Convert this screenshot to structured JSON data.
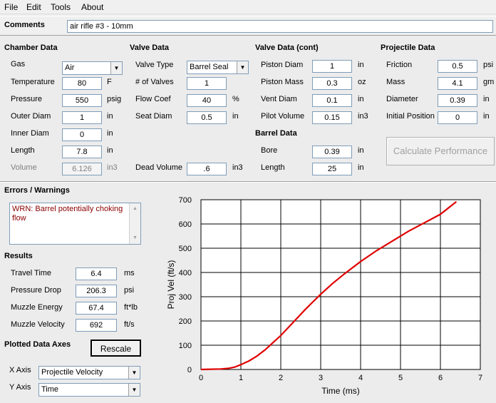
{
  "menu": {
    "file": "File",
    "edit": "Edit",
    "tools": "Tools",
    "about": "About"
  },
  "comments": {
    "label": "Comments",
    "value": "air rifle #3 - 10mm"
  },
  "chamber": {
    "title": "Chamber Data",
    "gas_label": "Gas",
    "gas_value": "Air",
    "temperature_label": "Temperature",
    "temperature_value": "80",
    "temperature_unit": "F",
    "pressure_label": "Pressure",
    "pressure_value": "550",
    "pressure_unit": "psig",
    "outer_diam_label": "Outer Diam",
    "outer_diam_value": "1",
    "outer_diam_unit": "in",
    "inner_diam_label": "Inner Diam",
    "inner_diam_value": "0",
    "inner_diam_unit": "in",
    "length_label": "Length",
    "length_value": "7.8",
    "length_unit": "in",
    "volume_label": "Volume",
    "volume_value": "6.126",
    "volume_unit": "in3"
  },
  "valve": {
    "title": "Valve Data",
    "type_label": "Valve Type",
    "type_value": "Barrel Seal",
    "num_label": "# of Valves",
    "num_value": "1",
    "flow_label": "Flow Coef",
    "flow_value": "40",
    "flow_unit": "%",
    "seat_label": "Seat Diam",
    "seat_value": "0.5",
    "seat_unit": "in",
    "dead_label": "Dead Volume",
    "dead_value": ".6",
    "dead_unit": "in3"
  },
  "valve_cont": {
    "title": "Valve Data (cont)",
    "piston_diam_label": "Piston Diam",
    "piston_diam_value": "1",
    "piston_diam_unit": "in",
    "piston_mass_label": "Piston Mass",
    "piston_mass_value": "0.3",
    "piston_mass_unit": "oz",
    "vent_label": "Vent Diam",
    "vent_value": "0.1",
    "vent_unit": "in",
    "pilot_label": "Pilot Volume",
    "pilot_value": "0.15",
    "pilot_unit": "in3"
  },
  "barrel": {
    "title": "Barrel Data",
    "bore_label": "Bore",
    "bore_value": "0.39",
    "bore_unit": "in",
    "length_label": "Length",
    "length_value": "25",
    "length_unit": "in"
  },
  "projectile": {
    "title": "Projectile Data",
    "friction_label": "Friction",
    "friction_value": "0.5",
    "friction_unit": "psi",
    "mass_label": "Mass",
    "mass_value": "4.1",
    "mass_unit": "gm",
    "diameter_label": "Diameter",
    "diameter_value": "0.39",
    "diameter_unit": "in",
    "initpos_label": "Initial Position",
    "initpos_value": "0",
    "initpos_unit": "in"
  },
  "calculate_label": "Calculate Performance",
  "errors": {
    "title": "Errors / Warnings",
    "message": "WRN: Barrel potentially choking flow"
  },
  "results": {
    "title": "Results",
    "travel_label": "Travel Time",
    "travel_value": "6.4",
    "travel_unit": "ms",
    "pdrop_label": "Pressure Drop",
    "pdrop_value": "206.3",
    "pdrop_unit": "psi",
    "energy_label": "Muzzle Energy",
    "energy_value": "67.4",
    "energy_unit": "ft*lb",
    "velocity_label": "Muzzle Velocity",
    "velocity_value": "692",
    "velocity_unit": "ft/s"
  },
  "axes": {
    "title": "Plotted Data Axes",
    "rescale_label": "Rescale",
    "x_label": "X Axis",
    "x_value": "Projectile Velocity",
    "y_label": "Y Axis",
    "y_value": "Time"
  },
  "colors": {
    "curve": "#e00000",
    "error_text": "#8b0000"
  },
  "chart_data": {
    "type": "line",
    "xlabel": "Time (ms)",
    "ylabel": "Proj Vel (ft/s)",
    "xlim": [
      0,
      7
    ],
    "ylim": [
      0,
      700
    ],
    "xticks": [
      "0",
      "1",
      "2",
      "3",
      "4",
      "5",
      "6",
      "7"
    ],
    "yticks": [
      "0",
      "100",
      "200",
      "300",
      "400",
      "500",
      "600",
      "700"
    ],
    "grid": true,
    "series": [
      {
        "color": "#e00000",
        "x": [
          0,
          0.5,
          0.7,
          0.85,
          1.0,
          1.2,
          1.4,
          1.6,
          1.8,
          2.0,
          2.2,
          2.4,
          2.6,
          2.8,
          3.0,
          3.3,
          3.6,
          4.0,
          4.4,
          4.8,
          5.2,
          5.6,
          6.0,
          6.4
        ],
        "y": [
          0,
          2,
          5,
          10,
          20,
          35,
          55,
          80,
          110,
          140,
          175,
          210,
          245,
          278,
          310,
          355,
          395,
          445,
          490,
          530,
          570,
          605,
          640,
          692
        ]
      }
    ]
  }
}
